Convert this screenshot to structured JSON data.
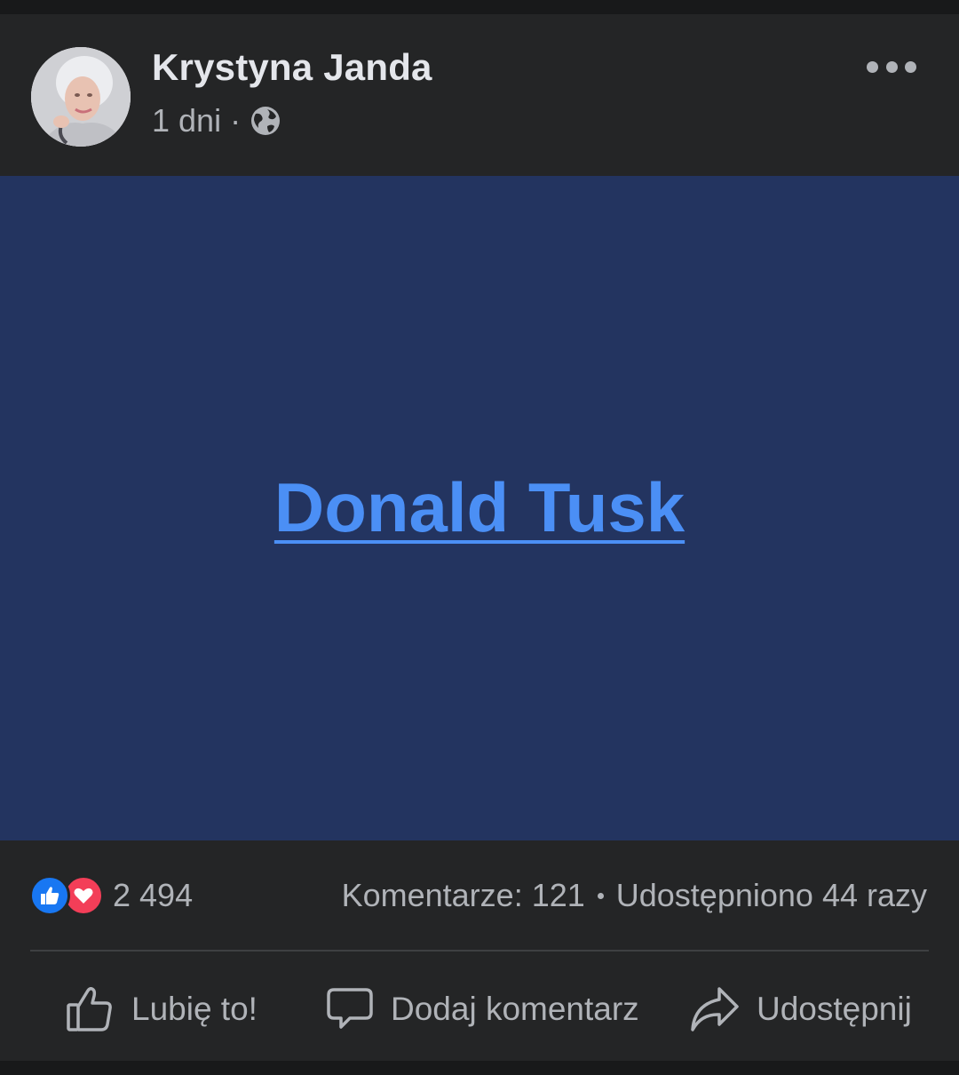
{
  "post": {
    "author": "Krystyna Janda",
    "time": "1 dni",
    "separator": "·",
    "visibility_icon": "globe-icon",
    "menu_icon": "more-options-icon"
  },
  "content": {
    "tag_text": "Donald Tusk",
    "background_color": "#233460",
    "link_color": "#4b8ff5"
  },
  "stats": {
    "reaction_icons": [
      "like-reaction-icon",
      "love-reaction-icon"
    ],
    "reactions_count": "2 494",
    "comments": "Komentarze: 121",
    "shares": "Udostępniono 44 razy"
  },
  "actions": {
    "like_label": "Lubię to!",
    "comment_label": "Dodaj komentarz",
    "share_label": "Udostępnij"
  }
}
